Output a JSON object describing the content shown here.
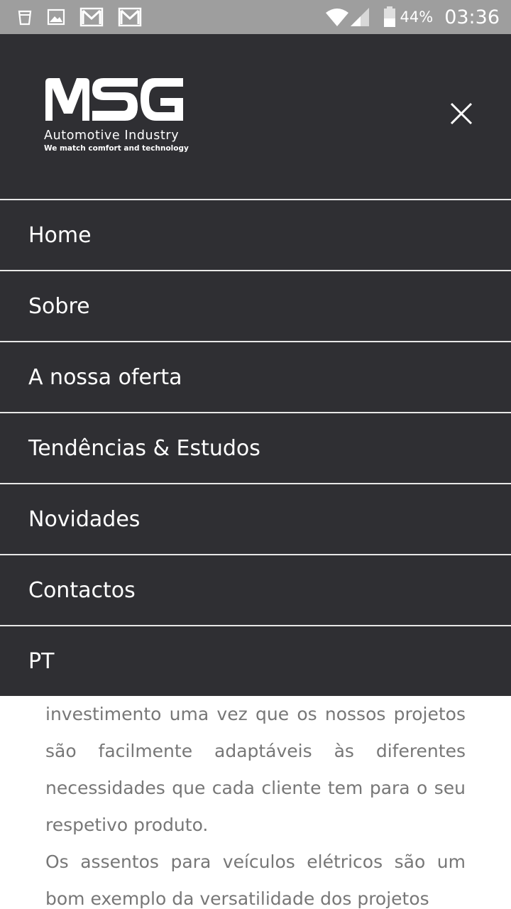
{
  "status_bar": {
    "battery_percent": "44%",
    "time": "03:36",
    "left_icons": [
      "cup-icon",
      "image-icon",
      "gmail-icon",
      "gmail-icon"
    ],
    "right_icons": [
      "wifi-icon",
      "signal-icon",
      "battery-icon"
    ]
  },
  "header": {
    "logo_text": "MSG",
    "logo_subtitle": "Automotive  Industry",
    "logo_tagline": "We match comfort and technology",
    "close_icon": "close-icon"
  },
  "menu": {
    "items": [
      {
        "label": "Home"
      },
      {
        "label": "Sobre"
      },
      {
        "label": "A nossa oferta"
      },
      {
        "label": "Tendências & Estudos"
      },
      {
        "label": "Novidades"
      },
      {
        "label": "Contactos"
      },
      {
        "label": "PT"
      }
    ]
  },
  "content": {
    "paragraph_1": "investimento uma vez que os nossos projetos são facilmente adaptáveis às diferentes necessidades que cada cliente tem para o seu respetivo produto.",
    "paragraph_2": "Os assentos para veículos elétricos são um bom exemplo da versatilidade dos projetos"
  },
  "colors": {
    "menu_background": "#2f2f33",
    "status_bar": "#9e9e9e",
    "divider": "#e8e8e8",
    "body_text": "#777777"
  }
}
